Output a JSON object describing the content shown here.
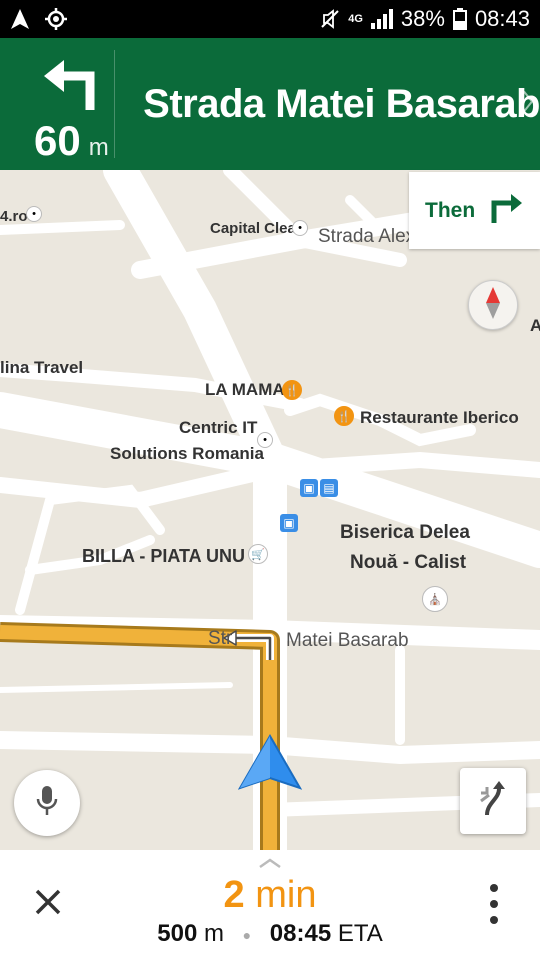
{
  "status_bar": {
    "battery_percent": "38%",
    "time": "08:43",
    "network": "4G",
    "icons": [
      "navigation-arrow-icon",
      "gps-icon",
      "mute-icon",
      "signal-icon",
      "battery-icon"
    ]
  },
  "nav_header": {
    "turn_direction": "left",
    "distance_value": "60",
    "distance_unit": "m",
    "street_name": "Strada Matei Basarab",
    "background_color": "#0b6b3a"
  },
  "then_card": {
    "label": "Then",
    "direction": "right"
  },
  "map": {
    "pois": [
      {
        "name": "4.ro"
      },
      {
        "name": "Capital Clean"
      },
      {
        "name": "lina Travel"
      },
      {
        "name": "LA MAMA"
      },
      {
        "name": "Restaurante Iberico"
      },
      {
        "name": "Centric IT"
      },
      {
        "name": "Solutions Romania"
      },
      {
        "name": "Biserica Delea"
      },
      {
        "name": "Nouă - Calist"
      },
      {
        "name": "BILLA - PIATA UNU"
      },
      {
        "name": "A"
      }
    ],
    "road_labels": [
      {
        "name": "Strada Alex"
      },
      {
        "name": "Matei Basarab"
      },
      {
        "name": "Str"
      }
    ],
    "route_color": "#f0b23a"
  },
  "bottom_panel": {
    "eta_minutes": "2",
    "eta_unit": "min",
    "remaining_distance": "500",
    "remaining_distance_unit": "m",
    "arrival_time": "08:45",
    "arrival_suffix": "ETA",
    "eta_color": "#f29412"
  }
}
